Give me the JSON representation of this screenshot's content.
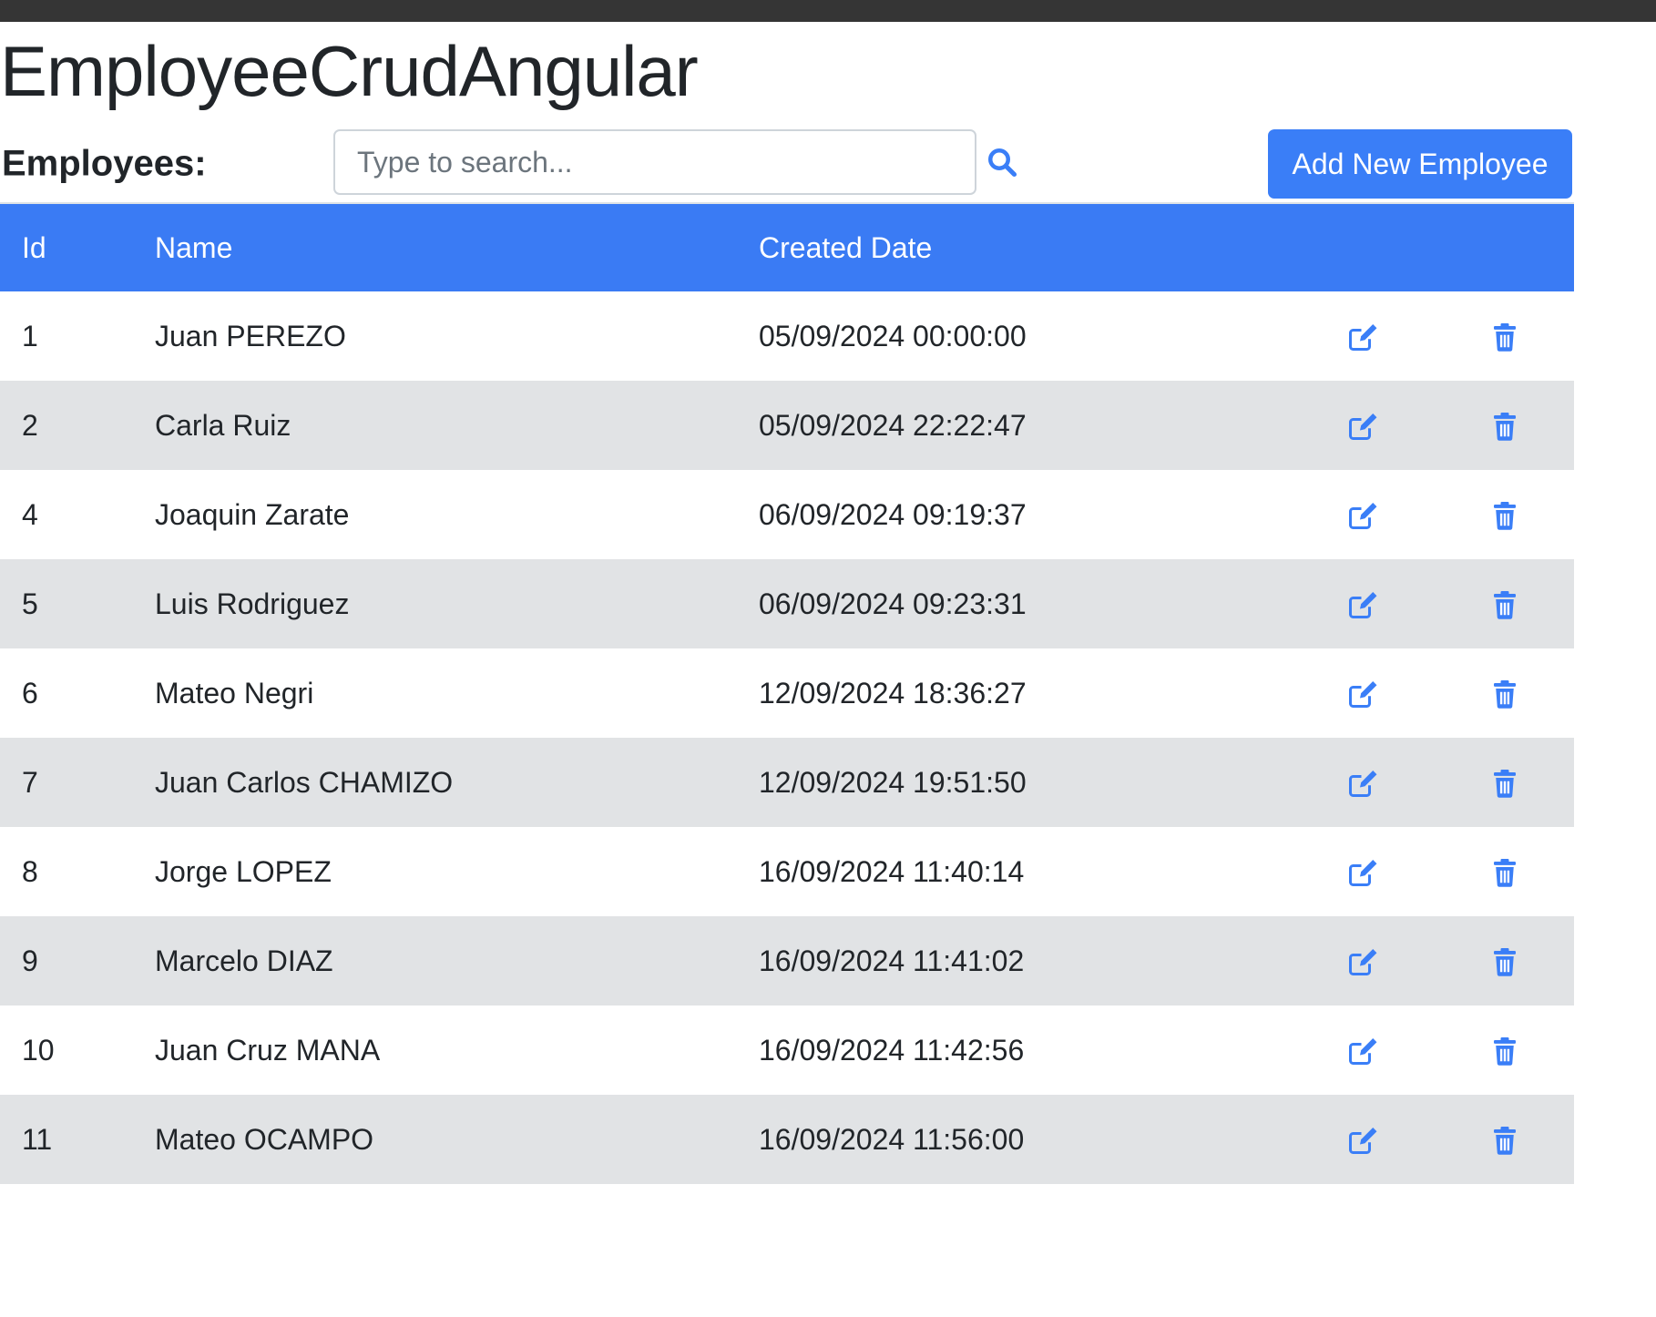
{
  "app": {
    "title": "EmployeeCrudAngular"
  },
  "toolbar": {
    "employees_label": "Employees:",
    "search_placeholder": "Type to search...",
    "search_value": "",
    "add_button_label": "Add New Employee"
  },
  "table": {
    "headers": {
      "id": "Id",
      "name": "Name",
      "created_date": "Created Date"
    },
    "rows": [
      {
        "id": "1",
        "name": "Juan PEREZO",
        "created_date": "05/09/2024 00:00:00"
      },
      {
        "id": "2",
        "name": "Carla Ruiz",
        "created_date": "05/09/2024 22:22:47"
      },
      {
        "id": "4",
        "name": "Joaquin Zarate",
        "created_date": "06/09/2024 09:19:37"
      },
      {
        "id": "5",
        "name": "Luis Rodriguez",
        "created_date": "06/09/2024 09:23:31"
      },
      {
        "id": "6",
        "name": "Mateo Negri",
        "created_date": "12/09/2024 18:36:27"
      },
      {
        "id": "7",
        "name": "Juan Carlos CHAMIZO",
        "created_date": "12/09/2024 19:51:50"
      },
      {
        "id": "8",
        "name": "Jorge LOPEZ",
        "created_date": "16/09/2024 11:40:14"
      },
      {
        "id": "9",
        "name": "Marcelo DIAZ",
        "created_date": "16/09/2024 11:41:02"
      },
      {
        "id": "10",
        "name": "Juan Cruz MANA",
        "created_date": "16/09/2024 11:42:56"
      },
      {
        "id": "11",
        "name": "Mateo OCAMPO",
        "created_date": "16/09/2024 11:56:00"
      }
    ]
  },
  "icons": {
    "search": "search-icon",
    "edit": "edit-icon",
    "delete": "trash-icon"
  },
  "colors": {
    "accent": "#3a7ef7",
    "header_bg": "#3a7bf4",
    "stripe": "#e1e3e5",
    "topbar": "#353535",
    "icon": "#3a7ef7"
  }
}
